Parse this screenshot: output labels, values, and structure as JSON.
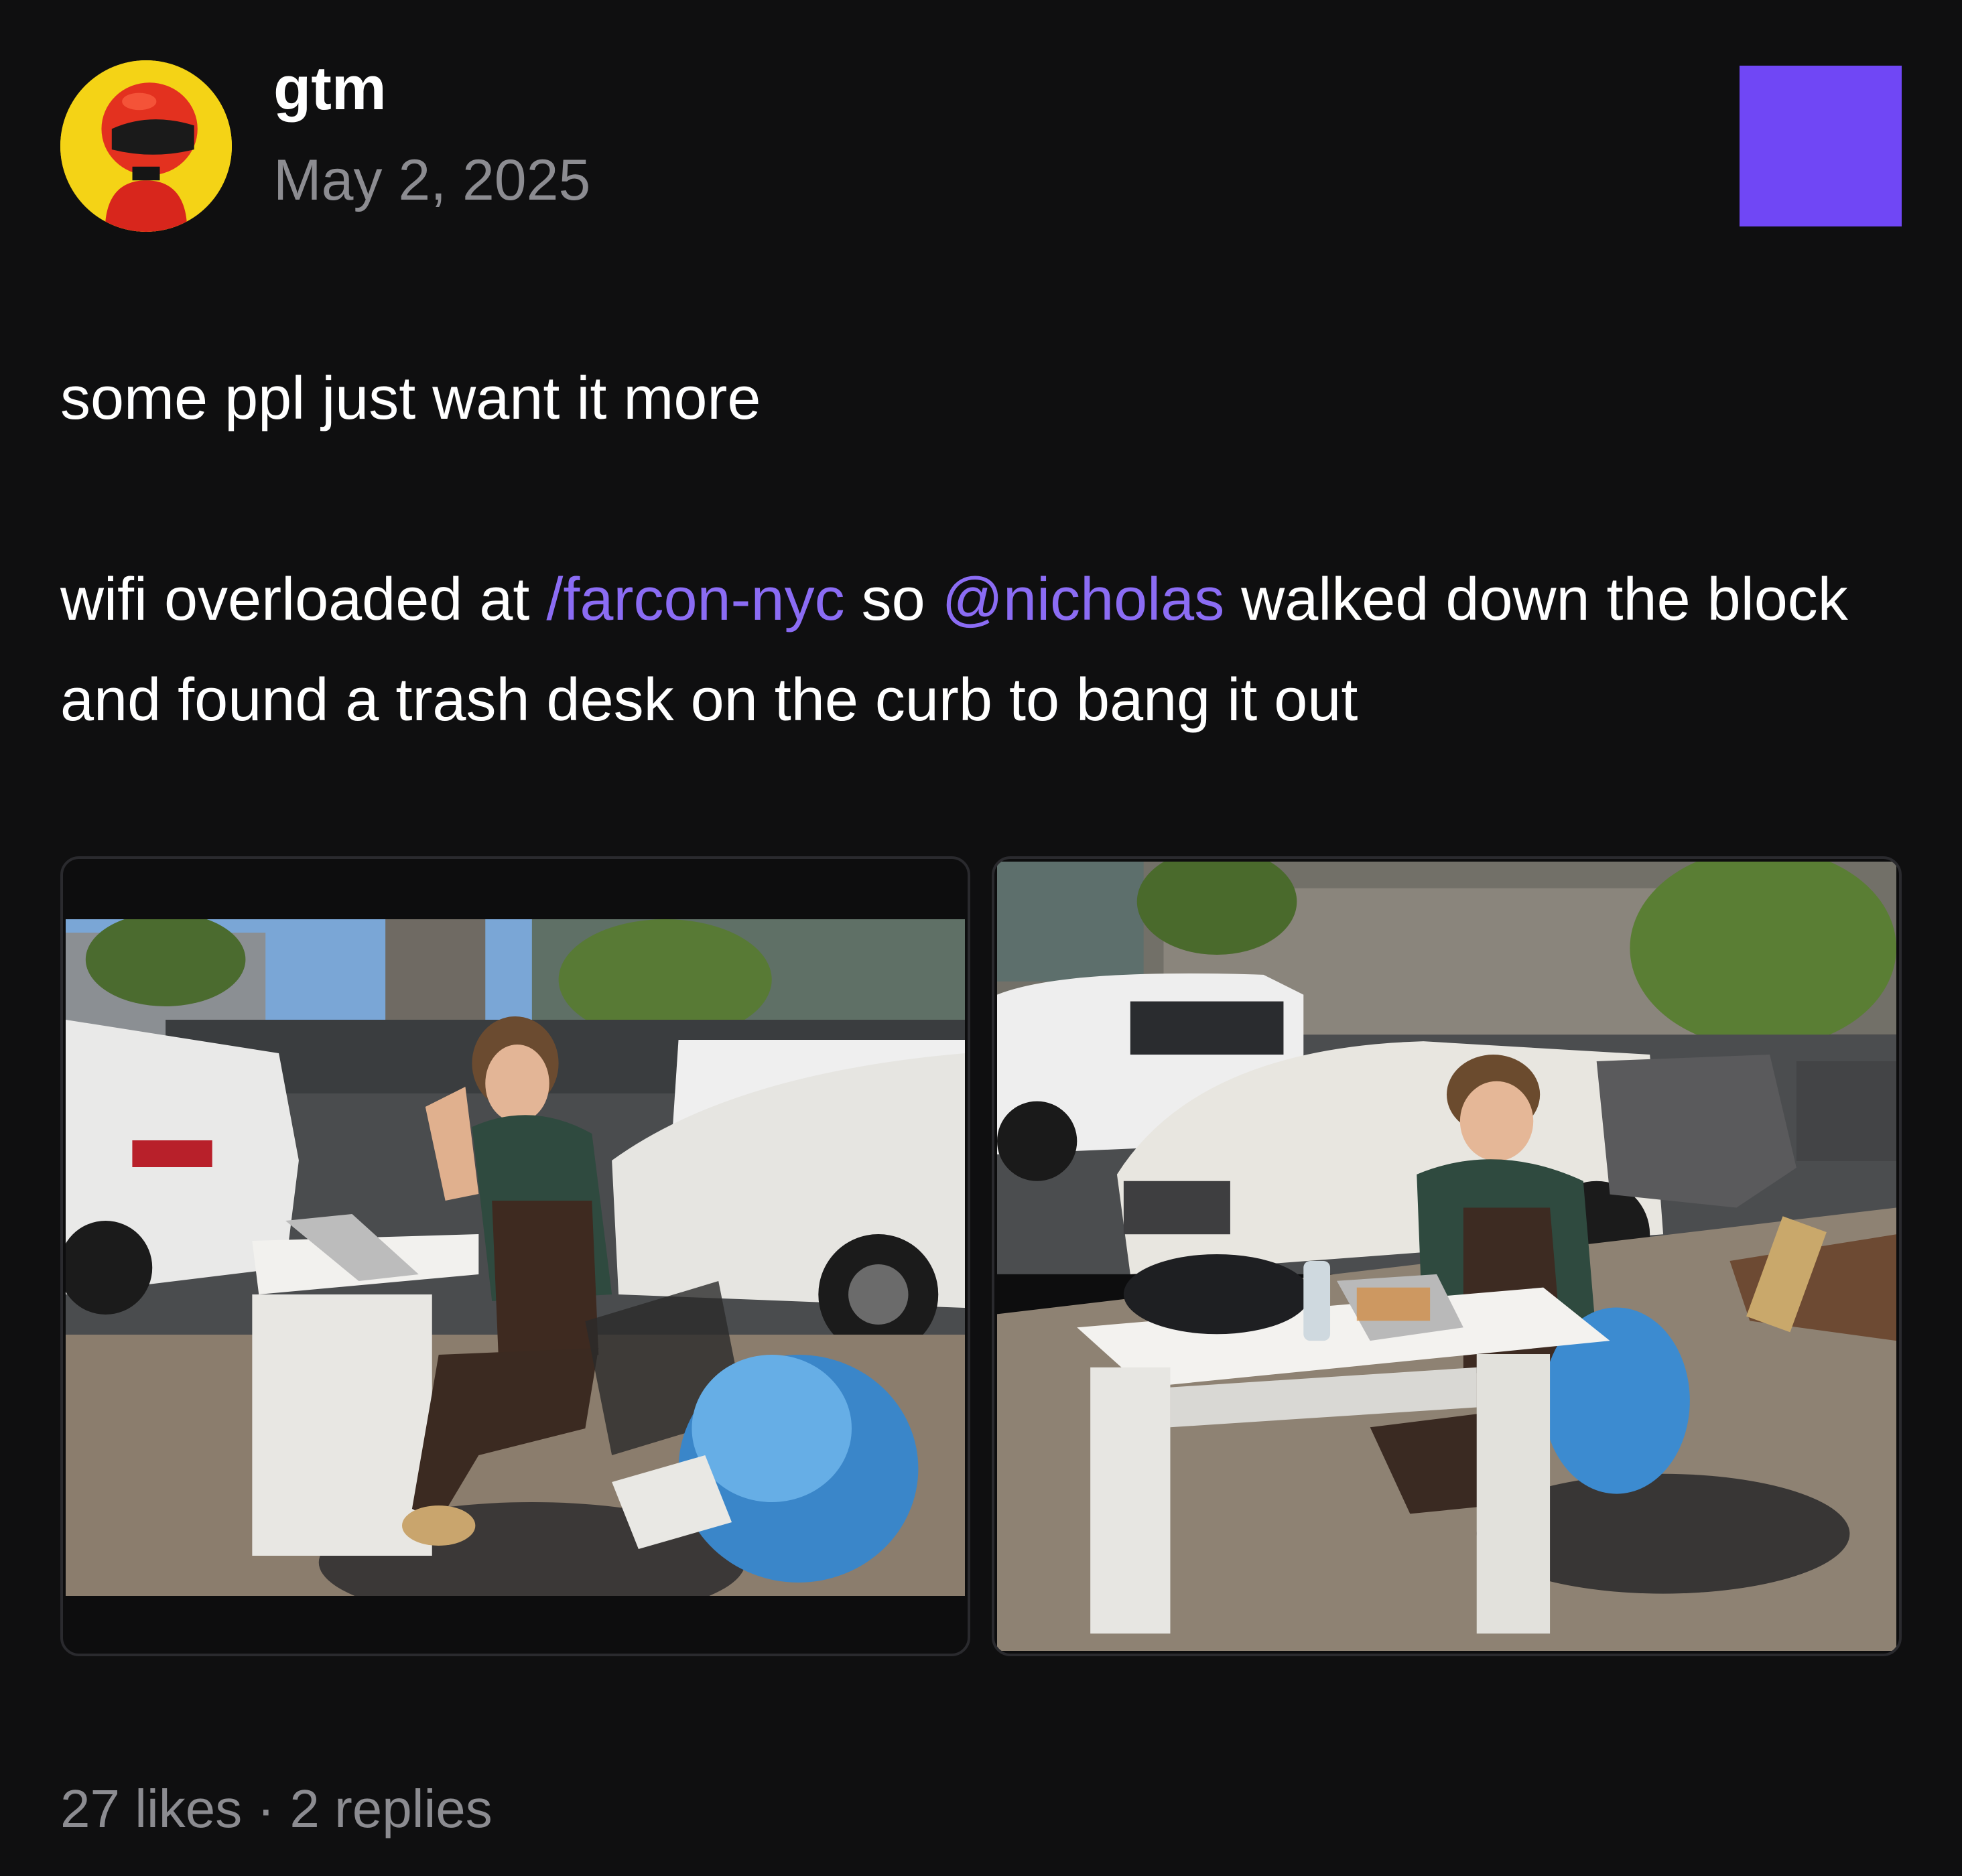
{
  "author": {
    "username": "gtm",
    "date": "May 2, 2025",
    "avatar_icon": "red-helmet-avatar"
  },
  "channel_badge_color": "#7047f5",
  "post": {
    "line1": "some ppl just want it more",
    "line2_prefix": "wifi overloaded at ",
    "channel_link": "/farcon-nyc",
    "line2_middle": " so ",
    "mention": "@nicholas",
    "line2_suffix": " walked down the block and found a trash desk on the curb to bang it out"
  },
  "images": [
    {
      "description": "photo-man-waving-at-curbside-desk"
    },
    {
      "description": "photo-man-typing-at-curbside-desk"
    }
  ],
  "footer": {
    "likes": "27 likes",
    "separator": " · ",
    "replies": "2 replies"
  },
  "colors": {
    "background": "#0f0f10",
    "link": "#8b6cf4",
    "muted": "#8c8c91"
  }
}
